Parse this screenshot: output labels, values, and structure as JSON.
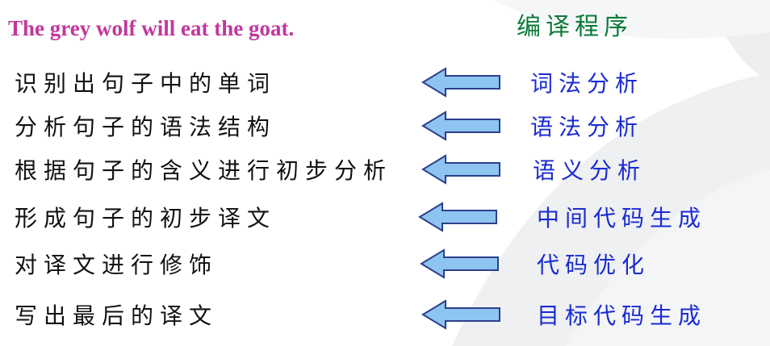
{
  "slide": {
    "sentence": "The grey wolf will eat the goat.",
    "compiler_title": "编译程序",
    "rows": [
      {
        "step": "识别出句子中的单词",
        "phase": "词法分析"
      },
      {
        "step": "分析句子的语法结构",
        "phase": "语法分析"
      },
      {
        "step": "根据句子的含义进行初步分析",
        "phase": "语义分析"
      },
      {
        "step": "形成句子的初步译文",
        "phase": "中间代码生成"
      },
      {
        "step": "对译文进行修饰",
        "phase": "代码优化"
      },
      {
        "step": "写出最后的译文",
        "phase": "目标代码生成"
      }
    ]
  },
  "colors": {
    "sentence": "#c2389c",
    "title": "#0b7a3a",
    "phase": "#1a2bd0",
    "arrow_fill": "#8ec5f0",
    "arrow_stroke": "#2b3f8c"
  },
  "icons": {
    "arrow": "left-arrow-icon"
  }
}
